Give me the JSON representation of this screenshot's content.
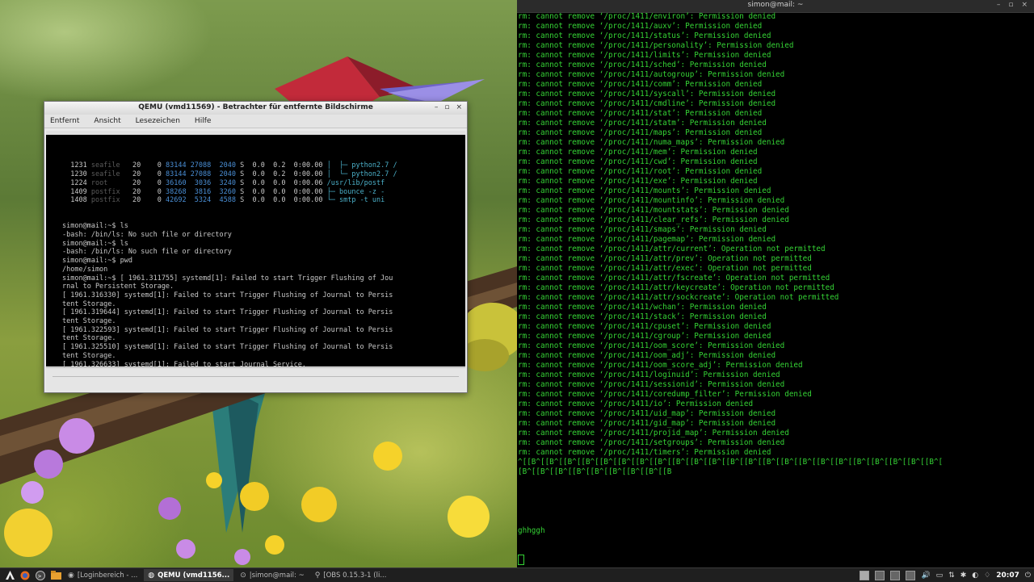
{
  "qemu": {
    "title": "QEMU (vmd11569) - Betrachter für entfernte Bildschirme",
    "menu": [
      "Entfernt",
      "Ansicht",
      "Lesezeichen",
      "Hilfe"
    ],
    "window_buttons": [
      "–",
      "▫",
      "×"
    ],
    "process_rows": [
      {
        "pid": "1231",
        "user": "seafile",
        "pr": "20",
        "ni": "0",
        "virt": "83144",
        "res": "27088",
        "shr": "2040",
        "s": "S",
        "cpu": "0.0",
        "mem": "0.2",
        "time": "0:00.00",
        "cmd": "│  ├─ python2.7 /"
      },
      {
        "pid": "1230",
        "user": "seafile",
        "pr": "20",
        "ni": "0",
        "virt": "83144",
        "res": "27088",
        "shr": "2040",
        "s": "S",
        "cpu": "0.0",
        "mem": "0.2",
        "time": "0:00.00",
        "cmd": "│  └─ python2.7 /"
      },
      {
        "pid": "1224",
        "user": "root",
        "pr": "20",
        "ni": "0",
        "virt": "36160",
        "res": "3036",
        "shr": "3240",
        "s": "S",
        "cpu": "0.0",
        "mem": "0.0",
        "time": "0:00.06",
        "cmd": "/usr/lib/postf"
      },
      {
        "pid": "1409",
        "user": "postfix",
        "pr": "20",
        "ni": "0",
        "virt": "38268",
        "res": "3816",
        "shr": "3260",
        "s": "S",
        "cpu": "0.0",
        "mem": "0.0",
        "time": "0:00.00",
        "cmd": "├─ bounce -z -"
      },
      {
        "pid": "1408",
        "user": "postfix",
        "pr": "20",
        "ni": "0",
        "virt": "42692",
        "res": "5324",
        "shr": "4588",
        "s": "S",
        "cpu": "0.0",
        "mem": "0.0",
        "time": "0:00.00",
        "cmd": "└─ smtp -t uni"
      }
    ],
    "console_lines": [
      "simon@mail:~$ ls",
      "-bash: /bin/ls: No such file or directory",
      "simon@mail:~$ ls",
      "-bash: /bin/ls: No such file or directory",
      "simon@mail:~$ pwd",
      "/home/simon",
      "simon@mail:~$ [ 1961.311755] systemd[1]: Failed to start Trigger Flushing of Jou",
      "rnal to Persistent Storage.",
      "[ 1961.316330] systemd[1]: Failed to start Trigger Flushing of Journal to Persis",
      "tent Storage.",
      "[ 1961.319644] systemd[1]: Failed to start Trigger Flushing of Journal to Persis",
      "tent Storage.",
      "[ 1961.322593] systemd[1]: Failed to start Trigger Flushing of Journal to Persis",
      "tent Storage.",
      "[ 1961.325510] systemd[1]: Failed to start Trigger Flushing of Journal to Persis",
      "tent Storage.",
      "[ 1961.326633] systemd[1]: Failed to start Journal Service.",
      "[ 1961.327313] systemd[1]: Dependency failed for Trigger Flushing of Journal to",
      "Persistent Storage."
    ]
  },
  "terminal": {
    "title": "simon@mail: ~",
    "window_buttons": [
      "–",
      "▫",
      "×"
    ],
    "lines": [
      "rm: cannot remove ‘/proc/1411/environ’: Permission denied",
      "rm: cannot remove ‘/proc/1411/auxv’: Permission denied",
      "rm: cannot remove ‘/proc/1411/status’: Permission denied",
      "rm: cannot remove ‘/proc/1411/personality’: Permission denied",
      "rm: cannot remove ‘/proc/1411/limits’: Permission denied",
      "rm: cannot remove ‘/proc/1411/sched’: Permission denied",
      "rm: cannot remove ‘/proc/1411/autogroup’: Permission denied",
      "rm: cannot remove ‘/proc/1411/comm’: Permission denied",
      "rm: cannot remove ‘/proc/1411/syscall’: Permission denied",
      "rm: cannot remove ‘/proc/1411/cmdline’: Permission denied",
      "rm: cannot remove ‘/proc/1411/stat’: Permission denied",
      "rm: cannot remove ‘/proc/1411/statm’: Permission denied",
      "rm: cannot remove ‘/proc/1411/maps’: Permission denied",
      "rm: cannot remove ‘/proc/1411/numa_maps’: Permission denied",
      "rm: cannot remove ‘/proc/1411/mem’: Permission denied",
      "rm: cannot remove ‘/proc/1411/cwd’: Permission denied",
      "rm: cannot remove ‘/proc/1411/root’: Permission denied",
      "rm: cannot remove ‘/proc/1411/exe’: Permission denied",
      "rm: cannot remove ‘/proc/1411/mounts’: Permission denied",
      "rm: cannot remove ‘/proc/1411/mountinfo’: Permission denied",
      "rm: cannot remove ‘/proc/1411/mountstats’: Permission denied",
      "rm: cannot remove ‘/proc/1411/clear_refs’: Permission denied",
      "rm: cannot remove ‘/proc/1411/smaps’: Permission denied",
      "rm: cannot remove ‘/proc/1411/pagemap’: Permission denied",
      "rm: cannot remove ‘/proc/1411/attr/current’: Operation not permitted",
      "rm: cannot remove ‘/proc/1411/attr/prev’: Operation not permitted",
      "rm: cannot remove ‘/proc/1411/attr/exec’: Operation not permitted",
      "rm: cannot remove ‘/proc/1411/attr/fscreate’: Operation not permitted",
      "rm: cannot remove ‘/proc/1411/attr/keycreate’: Operation not permitted",
      "rm: cannot remove ‘/proc/1411/attr/sockcreate’: Operation not permitted",
      "rm: cannot remove ‘/proc/1411/wchan’: Permission denied",
      "rm: cannot remove ‘/proc/1411/stack’: Permission denied",
      "rm: cannot remove ‘/proc/1411/cpuset’: Permission denied",
      "rm: cannot remove ‘/proc/1411/cgroup’: Permission denied",
      "rm: cannot remove ‘/proc/1411/oom_score’: Permission denied",
      "rm: cannot remove ‘/proc/1411/oom_adj’: Permission denied",
      "rm: cannot remove ‘/proc/1411/oom_score_adj’: Permission denied",
      "rm: cannot remove ‘/proc/1411/loginuid’: Permission denied",
      "rm: cannot remove ‘/proc/1411/sessionid’: Permission denied",
      "rm: cannot remove ‘/proc/1411/coredump_filter’: Permission denied",
      "rm: cannot remove ‘/proc/1411/io’: Permission denied",
      "rm: cannot remove ‘/proc/1411/uid_map’: Permission denied",
      "rm: cannot remove ‘/proc/1411/gid_map’: Permission denied",
      "rm: cannot remove ‘/proc/1411/projid_map’: Permission denied",
      "rm: cannot remove ‘/proc/1411/setgroups’: Permission denied",
      "rm: cannot remove ‘/proc/1411/timers’: Permission denied",
      "^[[B^[[B^[[B^[[B^[[B^[[B^[[B^[[B^[[B^[[B^[[B^[[B^[[B^[[B^[[B^[[B^[[B^[[B^[[B^[[B^[[B^[[B^[[B^[",
      "[B^[[B^[[B^[[B^[[B^[[B^[[B^[[B^[[B"
    ],
    "typed": "ghhggh",
    "text_color": "#35d335"
  },
  "taskbar": {
    "tasks": [
      {
        "icon": "firefox-icon",
        "label": "[Loginbereich - ...",
        "active": false
      },
      {
        "icon": "qemu-icon",
        "label": "QEMU (vmd1156...",
        "active": true
      },
      {
        "icon": "terminal-icon",
        "label": "|simon@mail: ~",
        "active": false
      },
      {
        "icon": "obs-icon",
        "label": "[OBS 0.15.3-1 (li...",
        "active": false
      }
    ],
    "clock": "20:07"
  }
}
